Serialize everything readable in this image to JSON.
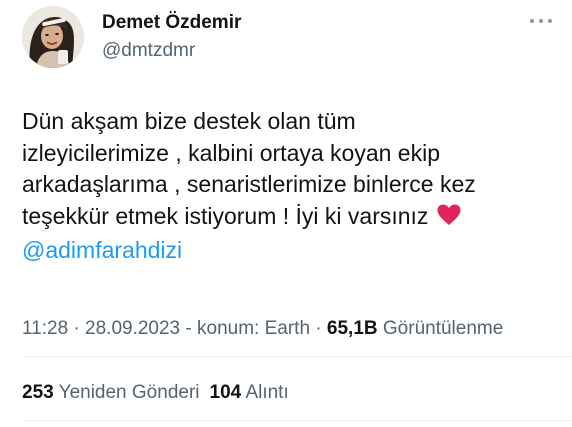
{
  "author": {
    "name": "Demet Özdemir",
    "handle": "@dmtzdmr"
  },
  "tweet": {
    "lines": [
      "Dün akşam bize destek olan tüm",
      "izleyicilerimize , kalbini ortaya koyan ekip",
      "arkadaşlarıma , senaristlerimize binlerce kez",
      "teşekkür etmek istiyorum ! İyi ki varsınız"
    ],
    "emoji": "red-heart-icon",
    "mention": "@adimfarahdizi"
  },
  "meta": {
    "time": "11:28",
    "date": "28.09.2023",
    "location": "konum: Earth",
    "views_count": "65,1B",
    "views_label": "Görüntülenme",
    "sep1": " · ",
    "sep2": " - ",
    "sep3": " · "
  },
  "stats": {
    "retweets_count": "253",
    "retweets_label": "Yeniden Gönderi",
    "quotes_count": "104",
    "quotes_label": "Alıntı"
  },
  "colors": {
    "text": "#0f1419",
    "secondary": "#536471",
    "link": "#1d9bf0",
    "heart": "#e0245e"
  }
}
